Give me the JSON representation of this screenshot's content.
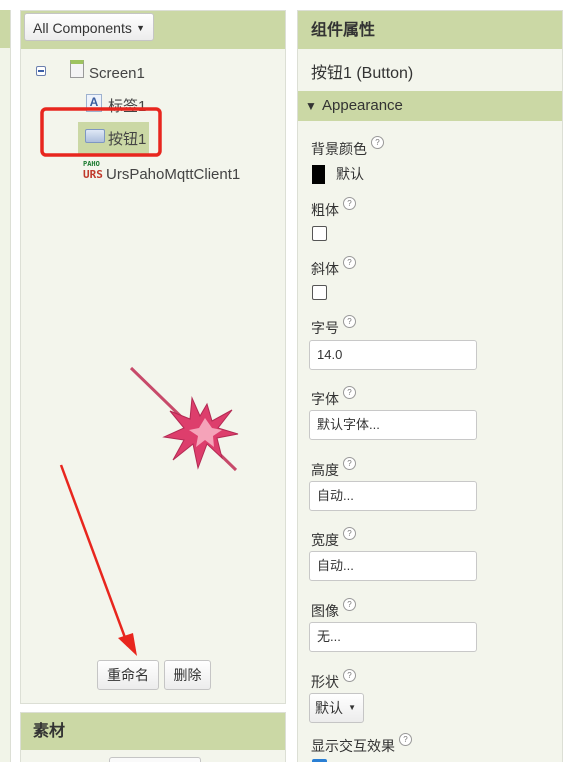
{
  "components_panel": {
    "dropdown_label": "All Components",
    "tree": {
      "screen": "Screen1",
      "label": "标签1",
      "button": "按钮1",
      "mqtt": "UrsPahoMqttClient1",
      "mqtt_icon_top": "PAHO",
      "mqtt_icon_bottom": "URS"
    },
    "rename_button": "重命名",
    "delete_button": "删除"
  },
  "media_panel": {
    "title": "素材"
  },
  "properties_panel": {
    "title": "组件属性",
    "component_name": "按钮1 (Button)",
    "section": "Appearance",
    "help_glyph": "?",
    "background_color": {
      "label": "背景颜色",
      "value": "默认",
      "swatch": "#000000"
    },
    "font_bold": {
      "label": "粗体"
    },
    "font_italic": {
      "label": "斜体"
    },
    "font_size": {
      "label": "字号",
      "value": "14.0"
    },
    "font_typeface": {
      "label": "字体",
      "value": "默认字体..."
    },
    "height": {
      "label": "高度",
      "value": "自动..."
    },
    "width": {
      "label": "宽度",
      "value": "自动..."
    },
    "image": {
      "label": "图像",
      "value": "无..."
    },
    "shape": {
      "label": "形状",
      "value": "默认"
    },
    "show_feedback": {
      "label": "显示交互效果"
    }
  },
  "colors": {
    "panel_header": "#cbd8a5",
    "panel_bg": "#f3f5ec",
    "annotation_red": "#e8261e",
    "annotation_pink": "#dd3e6c"
  }
}
